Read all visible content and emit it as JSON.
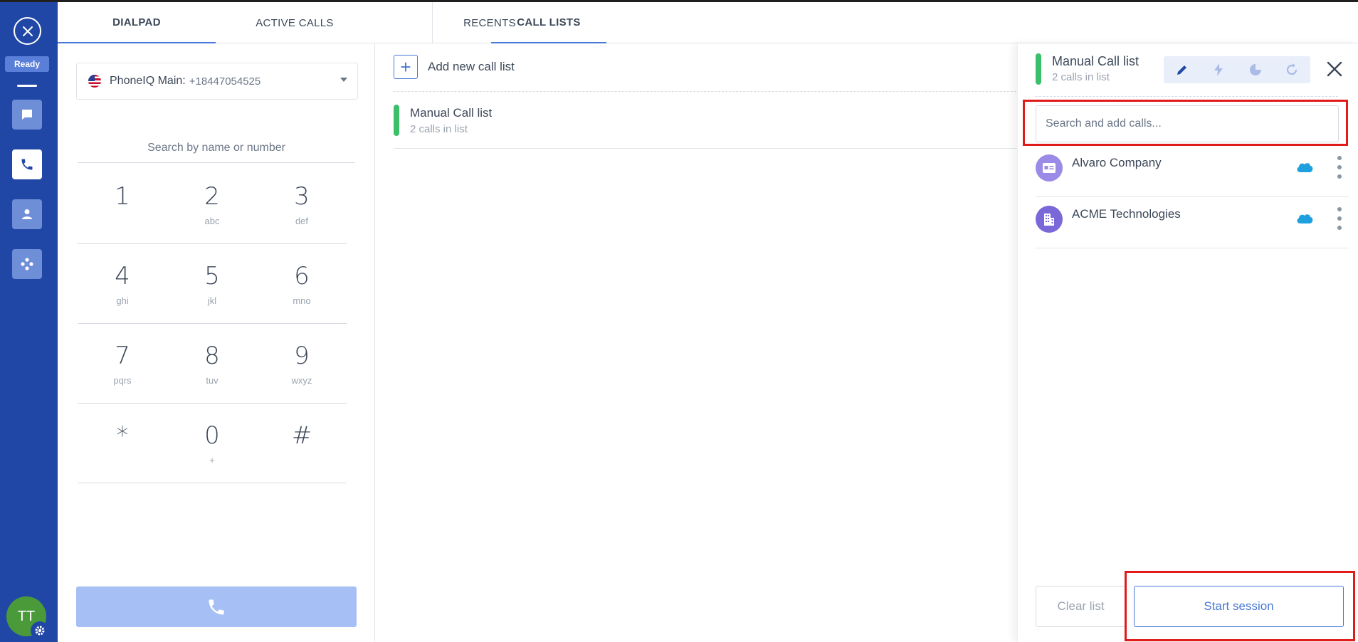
{
  "sidebar": {
    "status": "Ready",
    "avatar_initials": "TT",
    "nav": [
      {
        "name": "messages",
        "icon": "chat-bubble-icon",
        "active": false
      },
      {
        "name": "phone",
        "icon": "phone-icon",
        "active": true
      },
      {
        "name": "contacts",
        "icon": "person-icon",
        "active": false
      },
      {
        "name": "integrations",
        "icon": "dots-network-icon",
        "active": false
      }
    ]
  },
  "tabs": [
    {
      "label": "DIALPAD",
      "active": true
    },
    {
      "label": "ACTIVE CALLS",
      "active": false
    },
    {
      "label": "RECENTS",
      "active": false
    },
    {
      "label": "CALL LISTS",
      "active": true
    }
  ],
  "dialpad": {
    "line_name": "PhoneIQ Main:",
    "line_number": "+18447054525",
    "search_placeholder": "Search by name or number",
    "keys": [
      [
        {
          "digit": "1",
          "letters": ""
        },
        {
          "digit": "2",
          "letters": "abc"
        },
        {
          "digit": "3",
          "letters": "def"
        }
      ],
      [
        {
          "digit": "4",
          "letters": "ghi"
        },
        {
          "digit": "5",
          "letters": "jkl"
        },
        {
          "digit": "6",
          "letters": "mno"
        }
      ],
      [
        {
          "digit": "7",
          "letters": "pqrs"
        },
        {
          "digit": "8",
          "letters": "tuv"
        },
        {
          "digit": "9",
          "letters": "wxyz"
        }
      ],
      [
        {
          "digit": "*",
          "letters": ""
        },
        {
          "digit": "0",
          "letters": "+"
        },
        {
          "digit": "#",
          "letters": ""
        }
      ]
    ]
  },
  "call_lists": {
    "add_label": "Add new call list",
    "items": [
      {
        "title": "Manual Call list",
        "subtitle": "2 calls in list"
      }
    ]
  },
  "panel": {
    "title": "Manual Call list",
    "subtitle": "2 calls in list",
    "search_placeholder": "Search and add calls...",
    "contacts": [
      {
        "name": "Alvaro Company",
        "icon": "contact-card-icon",
        "color": "#9b8ae6"
      },
      {
        "name": "ACME Technologies",
        "icon": "building-icon",
        "color": "#7a67d8"
      }
    ],
    "clear_label": "Clear list",
    "start_label": "Start session"
  },
  "colors": {
    "sidebar": "#2147a6",
    "accent": "#4a78d6",
    "green": "#3bbf6b",
    "highlight": "#e11a1a",
    "salesforce": "#1ea0df"
  }
}
